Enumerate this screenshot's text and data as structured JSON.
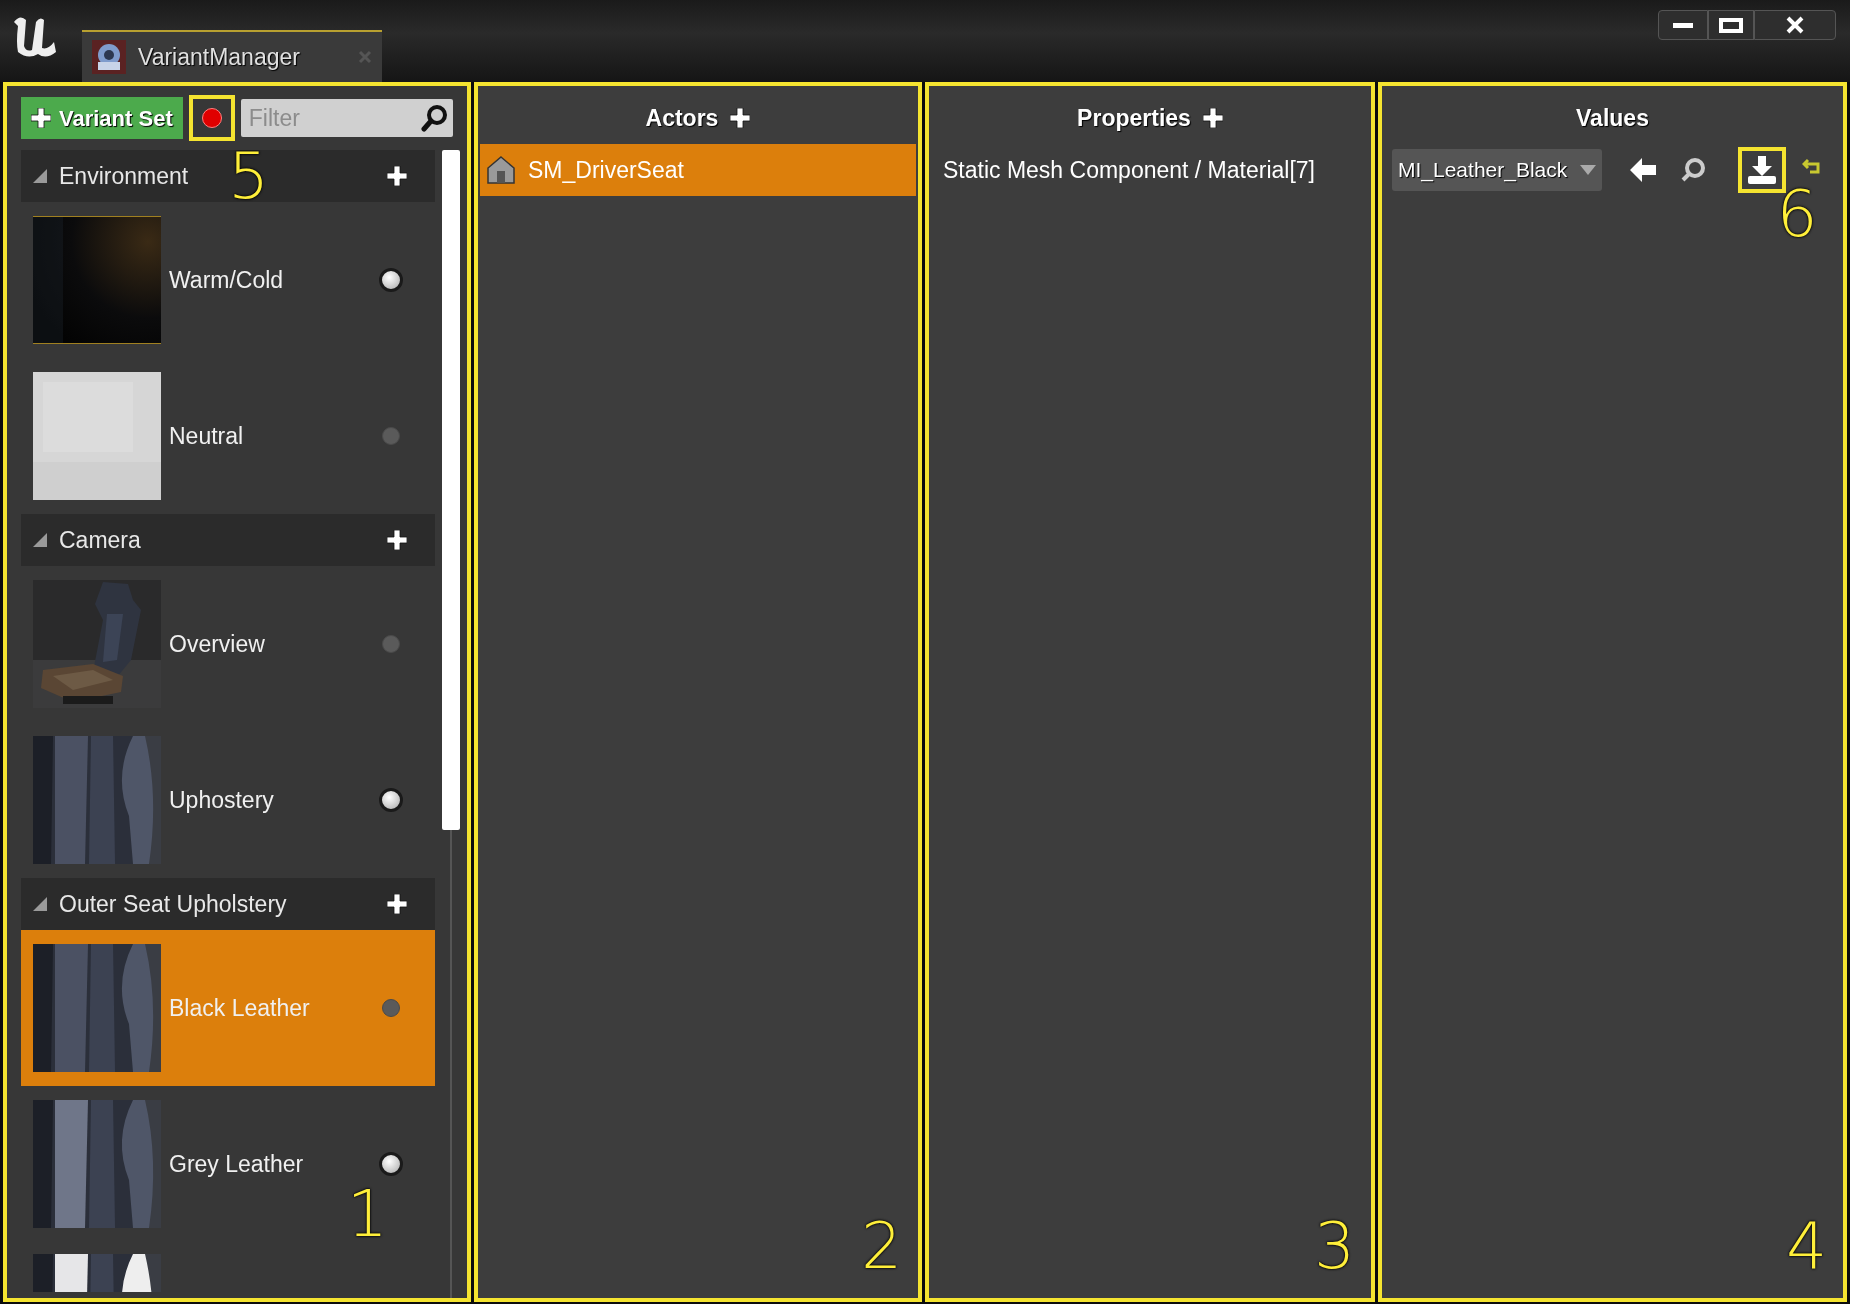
{
  "window": {
    "tab_title": "VariantManager"
  },
  "variant_panel": {
    "add_button": "Variant Set",
    "record": {
      "on": true
    },
    "filter": {
      "placeholder": "Filter"
    },
    "sets": [
      {
        "label": "Environment",
        "expanded": true,
        "callout": "5",
        "variants": [
          {
            "label": "Warm/Cold",
            "active": true,
            "selected": false
          },
          {
            "label": "Neutral",
            "active": false,
            "selected": false
          }
        ]
      },
      {
        "label": "Camera",
        "expanded": true,
        "variants": [
          {
            "label": "Overview",
            "active": false,
            "selected": false
          },
          {
            "label": "Uphostery",
            "active": true,
            "selected": false
          }
        ]
      },
      {
        "label": "Outer Seat Upholstery",
        "expanded": true,
        "variants": [
          {
            "label": "Black Leather",
            "active": false,
            "selected": true
          },
          {
            "label": "Grey Leather",
            "active": true,
            "selected": false,
            "callout": "1"
          },
          {
            "kind": "picture"
          }
        ]
      }
    ]
  },
  "actors_panel": {
    "title": "Actors",
    "callout": "2",
    "actors": [
      {
        "label": "SM_DriverSeat",
        "selected": true
      }
    ]
  },
  "properties_panel": {
    "title": "Properties",
    "callout": "3",
    "properties": [
      {
        "label": "Static Mesh Component / Material[7]",
        "selected": false
      }
    ]
  },
  "values_panel": {
    "title": "Values",
    "callout": "4",
    "value": "MI_Leather_Black",
    "save_callout": "6"
  }
}
